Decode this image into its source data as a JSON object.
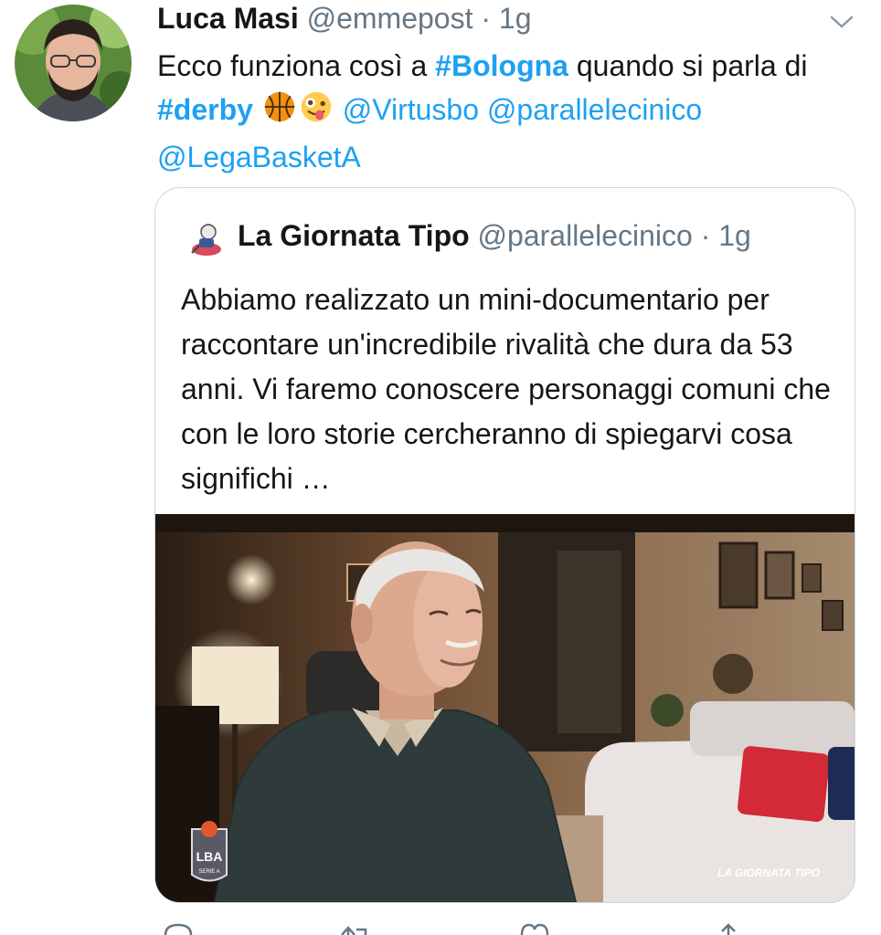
{
  "tweet": {
    "author_name": "Luca Masi",
    "author_handle": "@emmepost",
    "time": "· 1g",
    "text": {
      "p1": "Ecco funziona così a ",
      "tag1": "#Bologna",
      "p2": " quando si parla di ",
      "tag2": "#derby",
      "mention1": "@Virtusbo",
      "mention2": "@parallelecinico",
      "mention3": "@LegaBasketA"
    },
    "emojis": [
      "basketball-icon",
      "zany-face-icon"
    ]
  },
  "quoted": {
    "author_name": "La Giornata Tipo",
    "author_handle": "@parallelecinico",
    "time": "· 1g",
    "text": "Abbiamo realizzato un mini-documentario per raccontare un'incredibile rivalità che dura da 53 anni. Vi faremo conoscere personaggi comuni che con le loro storie cercheranno di spiegarvi cosa significhi …",
    "media": {
      "logo_left": "LBA",
      "logo_left_sub": "SERIE A",
      "logo_right": "LA GIORNATA TIPO"
    }
  },
  "icons": [
    "chevron-down-icon",
    "reply-icon",
    "retweet-icon",
    "like-icon",
    "share-icon"
  ],
  "colors": {
    "link": "#1da1f2",
    "secondary": "#657786",
    "border": "#ccd6dd",
    "text": "#14171a"
  }
}
